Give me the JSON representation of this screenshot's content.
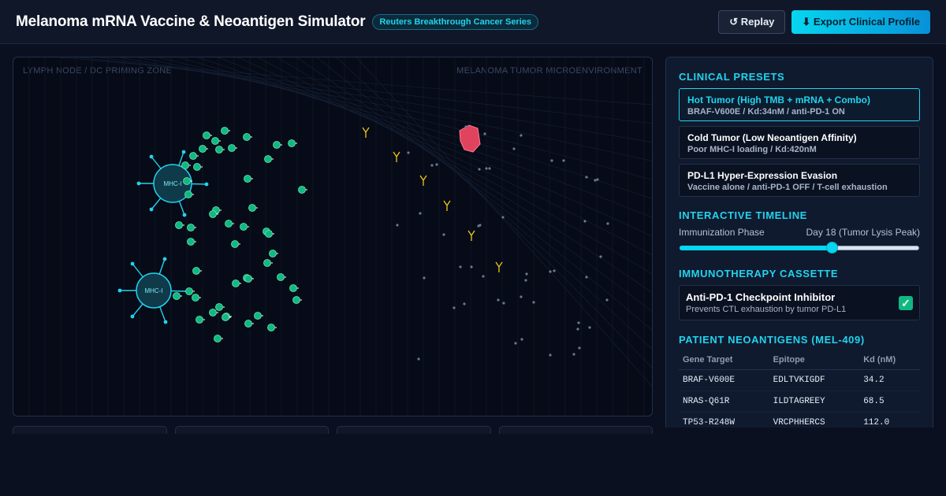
{
  "header": {
    "title": "Melanoma mRNA Vaccine & Neoantigen Simulator",
    "badge": "Reuters Breakthrough Cancer Series",
    "replay_label": "↺ Replay",
    "export_label": "⬇ Export Clinical Profile"
  },
  "viz": {
    "zone_left": "LYMPH NODE / DC PRIMING ZONE",
    "zone_right": "MELANOMA TUMOR MICROENVIRONMENT",
    "mhc_label": "MHC-I"
  },
  "panel": {
    "presets_title": "CLINICAL PRESETS",
    "presets": [
      {
        "name": "Hot Tumor (High TMB + mRNA + Combo)",
        "desc": "BRAF-V600E / Kd:34nM / anti-PD-1 ON",
        "active": true
      },
      {
        "name": "Cold Tumor (Low Neoantigen Affinity)",
        "desc": "Poor MHC-I loading / Kd:420nM",
        "active": false
      },
      {
        "name": "PD-L1 Hyper-Expression Evasion",
        "desc": "Vaccine alone / anti-PD-1 OFF / T-cell exhaustion",
        "active": false
      }
    ],
    "timeline_title": "INTERACTIVE TIMELINE",
    "timeline_label": "Immunization Phase",
    "timeline_value": "Day 18 (Tumor Lysis Peak)",
    "timeline_fraction": 0.63,
    "cassette_title": "IMMUNOTHERAPY CASSETTE",
    "cassette_name": "Anti-PD-1 Checkpoint Inhibitor",
    "cassette_desc": "Prevents CTL exhaustion by tumor PD-L1",
    "cassette_checked": true,
    "neo_title": "PATIENT NEOANTIGENS (MEL-409)",
    "neo_headers": [
      "Gene Target",
      "Epitope",
      "Kd (nM)"
    ],
    "neo_rows": [
      [
        "BRAF-V600E",
        "EDLTVKIGDF",
        "34.2"
      ],
      [
        "NRAS-Q61R",
        "ILDTAGREEY",
        "68.5"
      ],
      [
        "TP53-R248W",
        "VRCPHHERCS",
        "112.0"
      ]
    ]
  },
  "colors": {
    "accent": "#22d3ee",
    "tcell": "#10b981",
    "tumor": "#e0435e",
    "antibody": "#f5c518"
  }
}
